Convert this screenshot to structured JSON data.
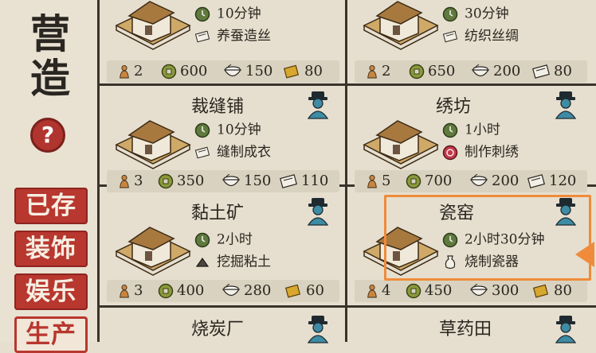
{
  "sidebar": {
    "title_line1": "营",
    "title_line2": "造",
    "help": "?",
    "buttons": [
      "已存",
      "装饰",
      "娱乐",
      "生产"
    ]
  },
  "cards": [
    {
      "name": "",
      "time": "10分钟",
      "product": "养蚕造丝",
      "costs": [
        "2",
        "600",
        "150",
        "80"
      ]
    },
    {
      "name": "",
      "time": "30分钟",
      "product": "纺织丝绸",
      "costs": [
        "2",
        "650",
        "200",
        "80"
      ]
    },
    {
      "name": "裁缝铺",
      "time": "10分钟",
      "product": "缝制成衣",
      "costs": [
        "3",
        "350",
        "150",
        "110"
      ]
    },
    {
      "name": "绣坊",
      "time": "1小时",
      "product": "制作刺绣",
      "costs": [
        "5",
        "700",
        "200",
        "120"
      ]
    },
    {
      "name": "黏土矿",
      "time": "2小时",
      "product": "挖掘粘土",
      "costs": [
        "3",
        "400",
        "280",
        "60"
      ]
    },
    {
      "name": "瓷窑",
      "time": "2小时30分钟",
      "product": "烧制瓷器",
      "costs": [
        "4",
        "450",
        "300",
        "80"
      ]
    },
    {
      "name": "烧炭厂",
      "time": "",
      "product": "",
      "costs": []
    },
    {
      "name": "草药田",
      "time": "",
      "product": "",
      "costs": []
    }
  ],
  "colors": {
    "accent": "#b8372f",
    "highlight": "#ef8b3a",
    "worker": "#2f6f85"
  }
}
